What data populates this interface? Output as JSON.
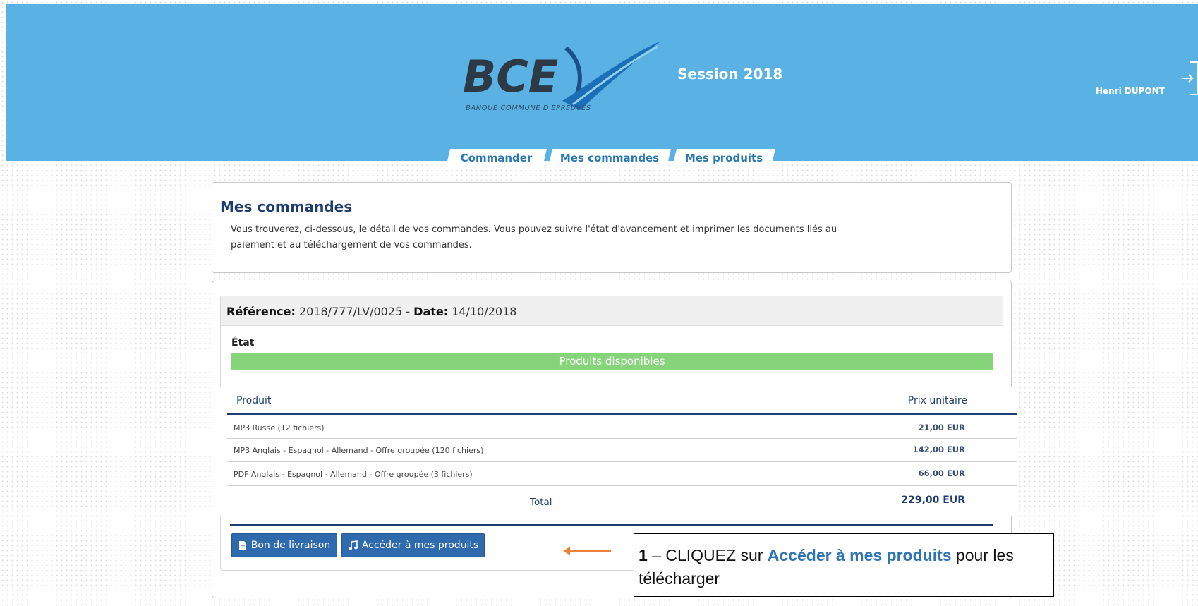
{
  "header": {
    "logo": {
      "brand": "BCE",
      "tagline": "BANQUE COMMUNE D'ÉPREUVES"
    },
    "session": "Session 2018",
    "user": "Henri DUPONT",
    "colors": {
      "background": "#5ab2e4",
      "logo_dark": "#2d3a45",
      "logo_blue": "#1b6fb7"
    }
  },
  "tabs": [
    {
      "label": "Commander"
    },
    {
      "label": "Mes commandes"
    },
    {
      "label": "Mes produits"
    }
  ],
  "intro": {
    "title": "Mes commandes",
    "line1": "Vous trouverez, ci-dessous, le détail de vos commandes. Vous pouvez suivre l'état d'avancement et imprimer les documents liés au",
    "line2": "paiement et au téléchargement de vos commandes."
  },
  "order": {
    "reference_label": "Référence:",
    "reference_value": "2018/777/LV/0025",
    "separator": "-",
    "date_label": "Date:",
    "date_value": "14/10/2018",
    "state_label": "État",
    "status": "Produits disponibles",
    "status_color": "#85d47a",
    "table": {
      "col_product": "Produit",
      "col_price": "Prix unitaire",
      "rows": [
        {
          "name": "MP3 Russe (12 fichiers)",
          "price": "21,00 EUR"
        },
        {
          "name": "MP3 Anglais - Espagnol - Allemand - Offre groupée (120 fichiers)",
          "price": "142,00 EUR"
        },
        {
          "name": "PDF Anglais - Espagnol - Allemand - Offre groupée (3 fichiers)",
          "price": "66,00 EUR"
        }
      ],
      "total_label": "Total",
      "total_value": "229,00 EUR"
    },
    "buttons": {
      "delivery": "Bon de livraison",
      "access": "Accéder à mes produits"
    },
    "accent_color": "#2f6aae"
  },
  "callout": {
    "step": "1",
    "dash": " – CLIQUEZ sur ",
    "highlight": "Accéder à mes produits",
    "rest": "  pour les télécharger",
    "arrow_color": "#e8823a"
  },
  "icons": {
    "logout": "logout-icon",
    "delivery": "document-icon",
    "access": "music-note-icon",
    "arrow": "arrow-left-icon"
  }
}
